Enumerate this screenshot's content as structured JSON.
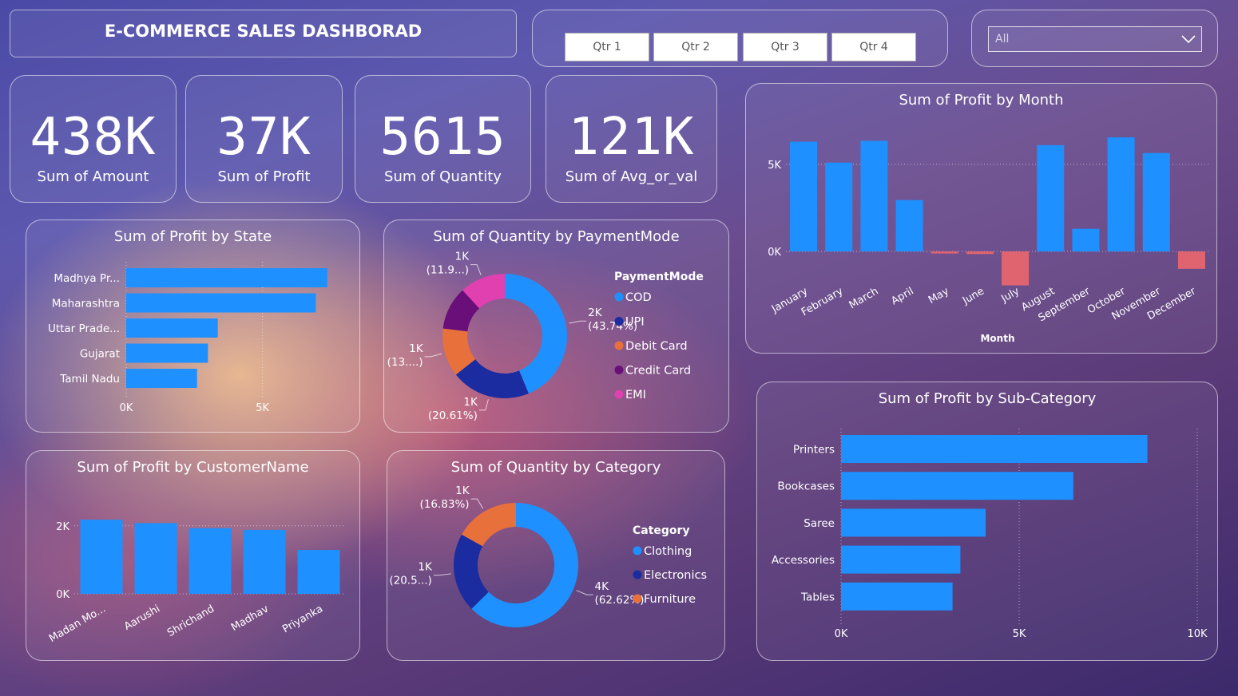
{
  "header": {
    "title": "E-COMMERCE SALES DASHBORAD"
  },
  "slicer": {
    "buttons": [
      "Qtr 1",
      "Qtr 2",
      "Qtr 3",
      "Qtr 4"
    ]
  },
  "filter": {
    "selected": "All"
  },
  "kpis": [
    {
      "value": "438K",
      "label": "Sum of Amount"
    },
    {
      "value": "37K",
      "label": "Sum of Profit"
    },
    {
      "value": "5615",
      "label": "Sum of Quantity"
    },
    {
      "value": "121K",
      "label": "Sum of Avg_or_val"
    }
  ],
  "colors": {
    "bar": "#1e90ff",
    "negative": "#e06470",
    "cod": "#1e90ff",
    "upi": "#1a2ca0",
    "debit": "#e8703a",
    "credit": "#6a0f7a",
    "emi": "#e040b0"
  },
  "chart_data": [
    {
      "id": "profit_by_state",
      "type": "bar",
      "orientation": "horizontal",
      "title": "Sum of Profit by State",
      "categories": [
        "Madhya Pr...",
        "Maharashtra",
        "Uttar Prade...",
        "Gujarat",
        "Tamil Nadu"
      ],
      "values": [
        7380,
        6960,
        3360,
        3000,
        2600
      ],
      "xticks": [
        "0K",
        "5K"
      ],
      "xlim": [
        0,
        8500
      ]
    },
    {
      "id": "quantity_by_paymentmode",
      "type": "pie",
      "donut": true,
      "title": "Sum of Quantity by PaymentMode",
      "legend_title": "PaymentMode",
      "slices": [
        {
          "name": "COD",
          "value": 43.74,
          "label_value": "2K",
          "label_pct": "(43.74%)"
        },
        {
          "name": "UPI",
          "value": 20.61,
          "label_value": "1K",
          "label_pct": "(20.61%)"
        },
        {
          "name": "Debit Card",
          "value": 12.6,
          "label_value": "1K",
          "label_pct": "(13....)"
        },
        {
          "name": "Credit Card",
          "value": 11.2,
          "label_value": "",
          "label_pct": ""
        },
        {
          "name": "EMI",
          "value": 11.85,
          "label_value": "1K",
          "label_pct": "(11.9...)"
        }
      ]
    },
    {
      "id": "profit_by_month",
      "type": "bar",
      "title": "Sum of Profit by Month",
      "xlabel": "Month",
      "categories": [
        "January",
        "February",
        "March",
        "April",
        "May",
        "June",
        "July",
        "August",
        "September",
        "October",
        "November",
        "December"
      ],
      "values": [
        6300,
        5100,
        6350,
        2950,
        -120,
        -150,
        -1950,
        6100,
        1300,
        6550,
        5650,
        -1000
      ],
      "yticks": [
        "5K",
        "0K"
      ],
      "ylim": [
        -2200,
        6600
      ]
    },
    {
      "id": "profit_by_customer",
      "type": "bar",
      "title": "Sum of Profit by CustomerName",
      "categories": [
        "Madan Mo...",
        "Aarushi",
        "Shrichand",
        "Madhav",
        "Priyanka"
      ],
      "values": [
        2180,
        2080,
        1930,
        1880,
        1290
      ],
      "yticks": [
        "2K",
        "0K"
      ],
      "ylim": [
        0,
        2300
      ]
    },
    {
      "id": "quantity_by_category",
      "type": "pie",
      "donut": true,
      "title": "Sum of Quantity by Category",
      "legend_title": "Category",
      "slices": [
        {
          "name": "Clothing",
          "value": 62.62,
          "label_value": "4K",
          "label_pct": "(62.62%)"
        },
        {
          "name": "Electronics",
          "value": 20.55,
          "label_value": "1K",
          "label_pct": "(20.5...)"
        },
        {
          "name": "Furniture",
          "value": 16.83,
          "label_value": "1K",
          "label_pct": "(16.83%)"
        }
      ]
    },
    {
      "id": "profit_by_subcategory",
      "type": "bar",
      "orientation": "horizontal",
      "title": "Sum of Profit by Sub-Category",
      "categories": [
        "Printers",
        "Bookcases",
        "Saree",
        "Accessories",
        "Tables"
      ],
      "values": [
        8600,
        6520,
        4060,
        3350,
        3130
      ],
      "xticks": [
        "0K",
        "5K",
        "10K"
      ],
      "xlim": [
        0,
        10000
      ]
    }
  ]
}
